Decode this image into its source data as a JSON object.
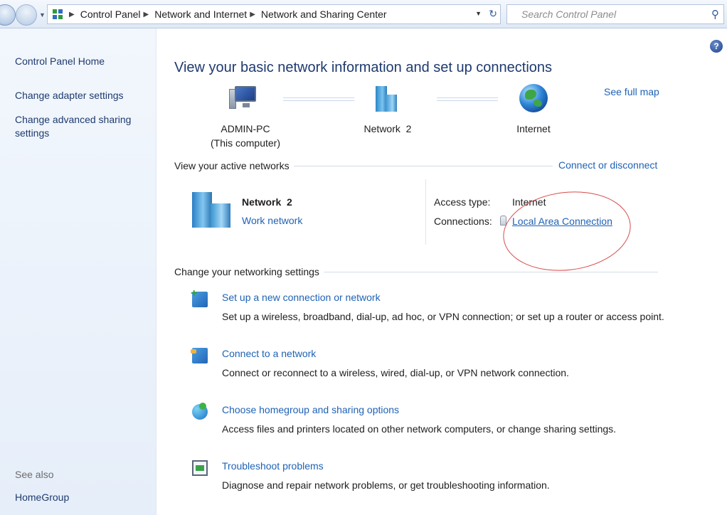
{
  "addressbar": {
    "breadcrumbs": [
      "Control Panel",
      "Network and Internet",
      "Network and Sharing Center"
    ],
    "search_placeholder": "Search Control Panel"
  },
  "sidebar": {
    "home": "Control Panel Home",
    "links": [
      "Change adapter settings",
      "Change advanced sharing settings"
    ],
    "see_also": "See also",
    "see_also_links": [
      "HomeGroup"
    ]
  },
  "main": {
    "title": "View your basic network information and set up connections",
    "see_full_map": "See full map",
    "map_nodes": [
      {
        "name": "ADMIN-PC",
        "sub": "(This computer)",
        "icon": "computer-icon"
      },
      {
        "name": "Network  2",
        "icon": "network-icon"
      },
      {
        "name": "Internet",
        "icon": "globe-icon"
      }
    ],
    "active_networks": {
      "heading": "View your active networks",
      "connect_link": "Connect or disconnect",
      "network_name": "Network  2",
      "network_type": "Work network",
      "access_type_label": "Access type:",
      "access_type_value": "Internet",
      "connections_label": "Connections:",
      "connection_link": "Local Area Connection"
    },
    "change_settings": {
      "heading": "Change your networking settings",
      "tasks": [
        {
          "title": "Set up a new connection or network",
          "desc": "Set up a wireless, broadband, dial-up, ad hoc, or VPN connection; or set up a router or access point.",
          "icon": "new-connection-icon"
        },
        {
          "title": "Connect to a network",
          "desc": "Connect or reconnect to a wireless, wired, dial-up, or VPN network connection.",
          "icon": "connect-network-icon"
        },
        {
          "title": "Choose homegroup and sharing options",
          "desc": "Access files and printers located on other network computers, or change sharing settings.",
          "icon": "homegroup-icon"
        },
        {
          "title": "Troubleshoot problems",
          "desc": "Diagnose and repair network problems, or get troubleshooting information.",
          "icon": "troubleshoot-icon"
        }
      ]
    }
  },
  "colors": {
    "link": "#1e62b5",
    "title": "#1e3a6e",
    "highlight": "#d74a4a"
  }
}
